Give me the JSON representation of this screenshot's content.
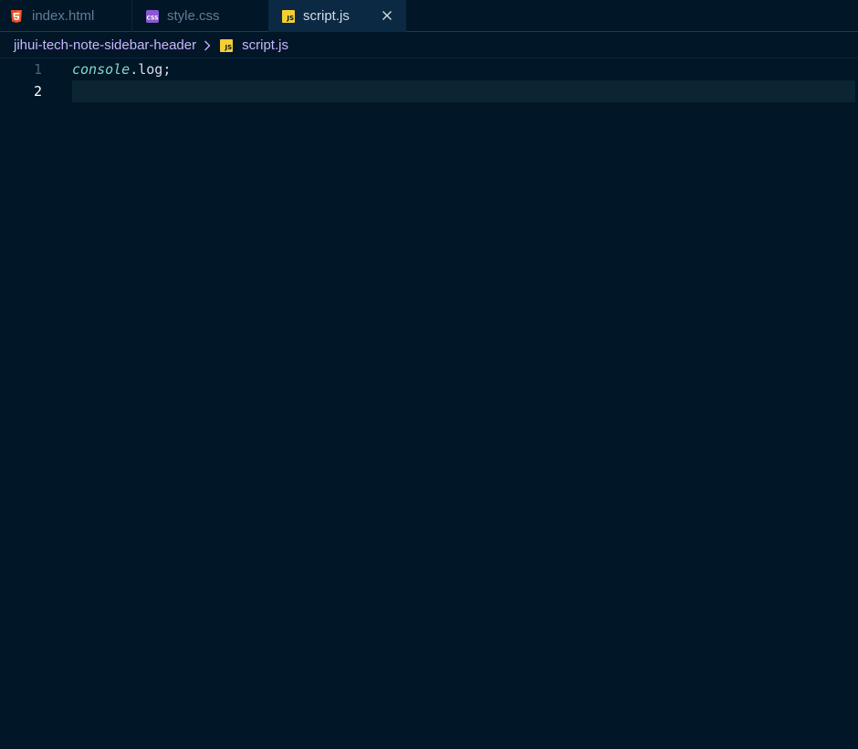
{
  "tabs": [
    {
      "label": "index.html",
      "icon": "html5-icon",
      "active": false
    },
    {
      "label": "style.css",
      "icon": "css-icon",
      "active": false
    },
    {
      "label": "script.js",
      "icon": "js-icon",
      "active": true
    }
  ],
  "breadcrumb": {
    "folder": "jihui-tech-note-sidebar-header",
    "file": "script.js"
  },
  "editor": {
    "lines": [
      {
        "number": "1",
        "tokens": {
          "object": "console",
          "dot": ".",
          "method": "log",
          "semicolon": ";"
        }
      },
      {
        "number": "2",
        "text": ""
      }
    ],
    "current_line": "2"
  },
  "icons": {
    "js_badge": "JS"
  },
  "colors": {
    "background": "#011627",
    "active_tab": "#0b2942",
    "html_icon": "#e44d26",
    "css_icon": "#8a58d2",
    "js_icon": "#f5cf32",
    "breadcrumb_text": "#c8b6ff",
    "keyword_console": "#7fdbca",
    "code_text": "#d6deeb",
    "line_number": "#4b6479",
    "active_line_number": "#ffffff"
  }
}
